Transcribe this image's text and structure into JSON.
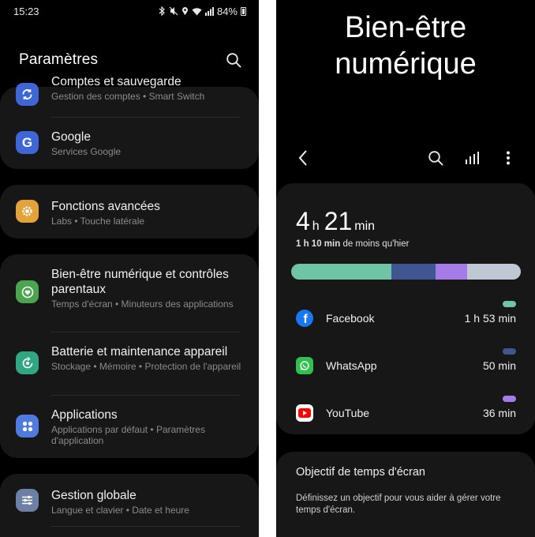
{
  "left": {
    "status": {
      "time": "15:23",
      "battery": "84%"
    },
    "header": {
      "title": "Paramètres"
    },
    "items": [
      {
        "title": "Comptes et sauvegarde",
        "subtitle": "Gestion des comptes  •  Smart Switch",
        "icon": "sync-icon",
        "color": "#3f66d6"
      },
      {
        "title": "Google",
        "subtitle": "Services Google",
        "icon": "google-icon",
        "color": "#3f66d6"
      },
      {
        "title": "Fonctions avancées",
        "subtitle": "Labs  •  Touche latérale",
        "icon": "gear-icon",
        "color": "#e4a23a"
      },
      {
        "title": "Bien-être numérique et contrôles parentaux",
        "subtitle": "Temps d'écran  •  Minuteurs des applications",
        "icon": "wellbeing-icon",
        "color": "#4aa54e"
      },
      {
        "title": "Batterie et maintenance appareil",
        "subtitle": "Stockage  •  Mémoire  •  Protection de l'appareil",
        "icon": "maintenance-icon",
        "color": "#2fa783"
      },
      {
        "title": "Applications",
        "subtitle": "Applications par défaut  •  Paramètres d'application",
        "icon": "apps-icon",
        "color": "#4f7ae0"
      },
      {
        "title": "Gestion globale",
        "subtitle": "Langue et clavier  •  Date et heure",
        "icon": "sliders-icon",
        "color": "#6c7fa4"
      }
    ]
  },
  "right": {
    "title": "Bien-être numérique",
    "usage": {
      "hours": "4",
      "hours_unit": "h",
      "minutes": "21",
      "minutes_unit": "min",
      "compare_bold": "1 h 10 min",
      "compare_rest": " de moins qu'hier",
      "segments": [
        {
          "fraction": 0.435,
          "color": "#6fc4a5"
        },
        {
          "fraction": 0.193,
          "color": "#3f5691"
        },
        {
          "fraction": 0.14,
          "color": "#a57be8"
        },
        {
          "fraction": 0.232,
          "color": "#c0c8d4"
        }
      ],
      "apps": [
        {
          "name": "Facebook",
          "time": "1 h 53 min",
          "pill_color": "#6fc4a5",
          "icon": "facebook-icon"
        },
        {
          "name": "WhatsApp",
          "time": "50 min",
          "pill_color": "#3f5691",
          "icon": "whatsapp-icon"
        },
        {
          "name": "YouTube",
          "time": "36 min",
          "pill_color": "#a57be8",
          "icon": "youtube-icon"
        }
      ]
    },
    "goal": {
      "title": "Objectif de temps d'écran",
      "description": "Définissez un objectif pour vous aider à gérer votre temps d'écran."
    }
  }
}
